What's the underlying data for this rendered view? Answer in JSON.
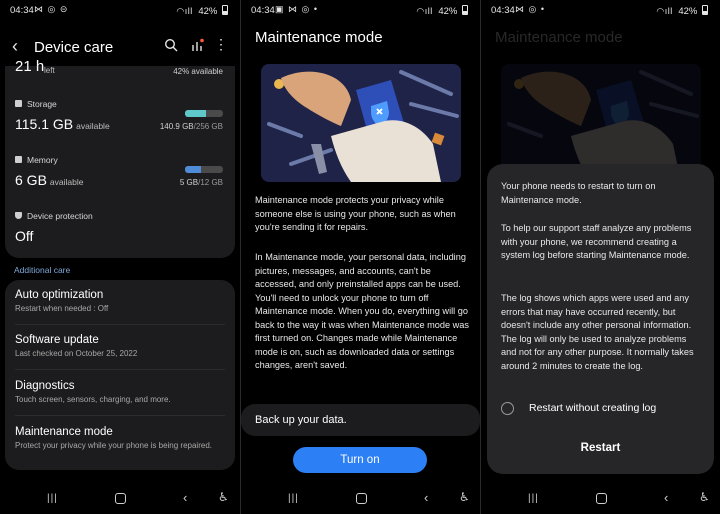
{
  "status_bars": [
    {
      "time": "04:34",
      "left_icons": "⋈ ◎ ⊝",
      "battery": "42%"
    },
    {
      "time": "04:34",
      "left_icons": "▣ ⋈ ◎ •",
      "battery": "42%"
    },
    {
      "time": "04:34",
      "left_icons": "⋈ ◎ •",
      "battery": "42%"
    }
  ],
  "device_care": {
    "title": "Device care",
    "battery": {
      "value": "21 h",
      "unit": "left",
      "available": "42% available"
    },
    "storage": {
      "label": "Storage",
      "value": "115.1 GB",
      "suffix": "available",
      "used": "140.9 GB",
      "total": "/256 GB",
      "fill_fraction": 0.55,
      "bar_color": "#5fc8c8"
    },
    "memory": {
      "label": "Memory",
      "value": "6 GB",
      "suffix": "available",
      "used": "5 GB",
      "total": "/12 GB",
      "fill_fraction": 0.42,
      "bar_color": "#4f8bd6"
    },
    "protection": {
      "label": "Device protection",
      "value": "Off"
    },
    "section_header": "Additional care",
    "items": [
      {
        "title": "Auto optimization",
        "subtitle": "Restart when needed : Off"
      },
      {
        "title": "Software update",
        "subtitle": "Last checked on October 25, 2022"
      },
      {
        "title": "Diagnostics",
        "subtitle": "Touch screen, sensors, charging, and more."
      },
      {
        "title": "Maintenance mode",
        "subtitle": "Protect your privacy while your phone is being repaired."
      }
    ]
  },
  "maintenance": {
    "title": "Maintenance mode",
    "para1": "Maintenance mode protects your privacy while someone else is using your phone, such as when you're sending it for repairs.",
    "para2": "In Maintenance mode, your personal data, including pictures, messages, and accounts, can't be accessed, and only preinstalled apps can be used. You'll need to unlock your phone to turn off Maintenance mode. When you do, everything will go back to the way it was when Maintenance mode was first turned on. Changes made while Maintenance mode is on, such as downloaded data or settings changes, aren't saved.",
    "backup_label": "Back up your data.",
    "turn_on_label": "Turn on"
  },
  "dialog": {
    "p1": "Your phone needs to restart to turn on Maintenance mode.",
    "p2": "To help our support staff analyze any problems with your phone, we recommend creating a system log before starting Maintenance mode.",
    "p3": "The log shows which apps were used and any errors that may have occurred recently, but doesn't include any other personal information. The log will only be used to analyze problems and not for any other purpose. It normally takes around 2 minutes to create the log.",
    "option_label": "Restart without creating log",
    "restart_label": "Restart"
  },
  "colors": {
    "accent": "#2d7ff5",
    "section_header": "#7fa8d9",
    "card": "#1c1c1e",
    "dialog": "#262628"
  },
  "nav_icons": [
    "recent-apps-icon",
    "home-icon",
    "back-icon",
    "accessibility-icon"
  ]
}
